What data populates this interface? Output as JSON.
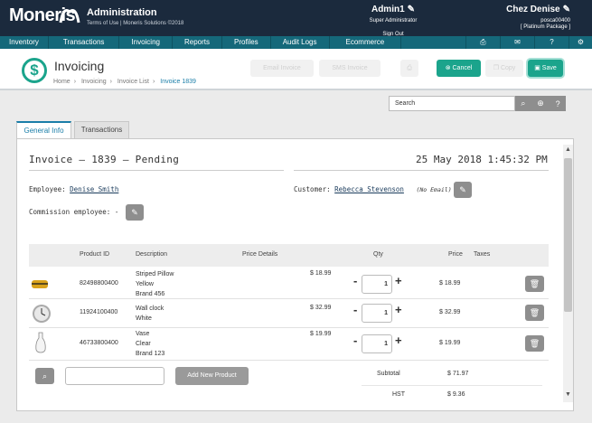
{
  "topbar": {
    "brand": "Moneris",
    "app_title": "Administration",
    "app_sub": "Terms of Use | Moneris Solutions ©2018",
    "user_name": "Admin1",
    "user_role": "Super Administrator",
    "signout": "Sign Out",
    "store_name": "Chez Denise",
    "store_id": "posca00400",
    "store_plan": "[ Platinum Package ]"
  },
  "nav": {
    "items": [
      "Inventory",
      "Transactions",
      "Invoicing",
      "Reports",
      "Profiles",
      "Audit Logs",
      "Ecommerce"
    ],
    "icons": [
      "printer-icon",
      "mail-icon",
      "help-icon",
      "settings-icon"
    ]
  },
  "header": {
    "title": "Invoicing",
    "breadcrumb": [
      "Home",
      "Invoicing",
      "Invoice List",
      "Invoice 1839"
    ],
    "email_invoice": "Email Invoice",
    "sms_invoice": "SMS Invoice",
    "cancel": "Cancel",
    "copy": "Copy",
    "save": "Save"
  },
  "search": {
    "placeholder": "Search"
  },
  "tabs": [
    "General Info",
    "Transactions"
  ],
  "invoice": {
    "title": "Invoice – 1839 – Pending",
    "date": "25 May 2018 1:45:32 PM",
    "employee_label": "Employee:",
    "employee": "Denise Smith",
    "customer_label": "Customer:",
    "customer": "Rebecca Stevenson",
    "no_email": "(No Email)",
    "commission_label": "Commission employee: -"
  },
  "table": {
    "headers": [
      "Product ID",
      "Description",
      "Price Details",
      "Qty",
      "Price",
      "Taxes"
    ],
    "rows": [
      {
        "id": "82498800400",
        "desc": [
          "Striped Pillow",
          "Yellow",
          "Brand 456"
        ],
        "unit": "$ 18.99",
        "qty": "1",
        "price": "$ 18.99",
        "thumb": "pillow-thumb"
      },
      {
        "id": "11924100400",
        "desc": [
          "Wall clock",
          "White"
        ],
        "unit": "$ 32.99",
        "qty": "1",
        "price": "$ 32.99",
        "thumb": "clock-thumb"
      },
      {
        "id": "46733800400",
        "desc": [
          "Vase",
          "Clear",
          "Brand 123"
        ],
        "unit": "$ 19.99",
        "qty": "1",
        "price": "$ 19.99",
        "thumb": "vase-thumb"
      }
    ]
  },
  "footer": {
    "add_new": "Add New Product",
    "subtotal_label": "Subtotal",
    "subtotal": "$ 71.97",
    "hst_label": "HST",
    "hst": "$ 9.36"
  },
  "colors": {
    "topbar": "#1b2a3d",
    "nav": "#15687a",
    "accent": "#1ba48c",
    "link": "#1a7ea8"
  }
}
